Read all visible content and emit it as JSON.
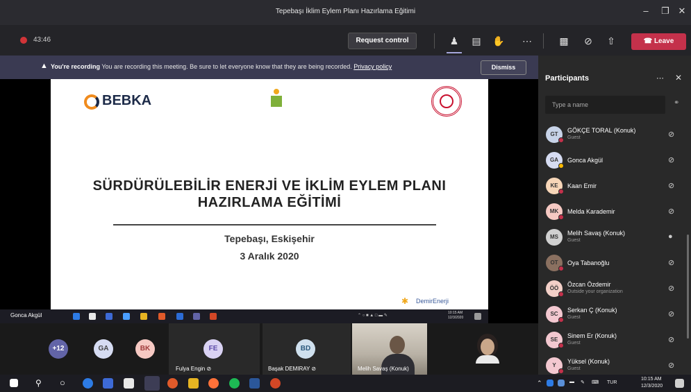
{
  "window": {
    "title": "Tepebaşı İklim Eylem Planı Hazırlama Eğitimi"
  },
  "toolbar": {
    "timer": "43:46",
    "request_control": "Request control",
    "leave": "Leave"
  },
  "banner": {
    "bold": "You're recording",
    "message": "You are recording this meeting. Be sure to let everyone know that they are being recorded.",
    "link": "Privacy policy",
    "dismiss": "Dismiss"
  },
  "slide": {
    "logo_text": "BEBKA",
    "title_line1": "SÜRDÜRÜLEBİLİR ENERJİ VE İKLİM EYLEM PLANI",
    "title_line2": "HAZIRLAMA EĞİTİMİ",
    "location": "Tepebaşı, Eskişehir",
    "date": "3 Aralık 2020",
    "footer_brand": "DemirEnerji"
  },
  "shared_taskbar": {
    "presenter": "Gonca Akgül",
    "time": "10:15 AM",
    "date": "12/3/2020"
  },
  "gallery": {
    "overflow": "+12",
    "tiles": [
      {
        "initials": "GA",
        "color": "#d6dcf2"
      },
      {
        "initials": "BK",
        "color": "#f6c9c3"
      },
      {
        "initials": "FE",
        "name": "Fulya Engin",
        "color": "#d9d2f3"
      },
      {
        "initials": "BD",
        "name": "Başak DEMIRAY",
        "color": "#cfe0ee"
      },
      {
        "name": "Melih Savaş (Konuk)"
      }
    ]
  },
  "participants": {
    "title": "Participants",
    "search_placeholder": "Type a name",
    "list": [
      {
        "initials": "GT",
        "name": "GÖKÇE TORAL (Konuk)",
        "role": "Guest",
        "color": "#c7d3e8",
        "status": "#c4314b"
      },
      {
        "initials": "GA",
        "name": "Gonca Akgül",
        "role": "",
        "color": "#d6dcf2",
        "status": "#f8b800"
      },
      {
        "initials": "KE",
        "name": "Kaan Emir",
        "role": "",
        "color": "#f7d6b8",
        "status": "#c4314b"
      },
      {
        "initials": "MK",
        "name": "Melda Karademir",
        "role": "",
        "color": "#f6c9c3",
        "status": "#c4314b"
      },
      {
        "initials": "MS",
        "name": "Melih Savaş (Konuk)",
        "role": "Guest",
        "color": "#d0d0d0",
        "status": ""
      },
      {
        "initials": "OT",
        "name": "Oya Tabanoğlu",
        "role": "",
        "color": "#8a7060",
        "status": "#c4314b"
      },
      {
        "initials": "ÖÖ",
        "name": "Özcan Özdemir",
        "role": "Outside your organization",
        "color": "#f3d0c8",
        "status": "#c4314b"
      },
      {
        "initials": "SC",
        "name": "Serkan Ç (Konuk)",
        "role": "Guest",
        "color": "#f3c8d0",
        "status": "#c4314b"
      },
      {
        "initials": "SE",
        "name": "Sinem Er (Konuk)",
        "role": "Guest",
        "color": "#f3c8d0",
        "status": "#c4314b"
      },
      {
        "initials": "Y",
        "name": "Yüksel (Konuk)",
        "role": "Guest",
        "color": "#f3c8d0",
        "status": "#c4314b"
      }
    ]
  },
  "taskbar": {
    "language": "TUR",
    "time": "10:15 AM",
    "date": "12/3/2020"
  }
}
